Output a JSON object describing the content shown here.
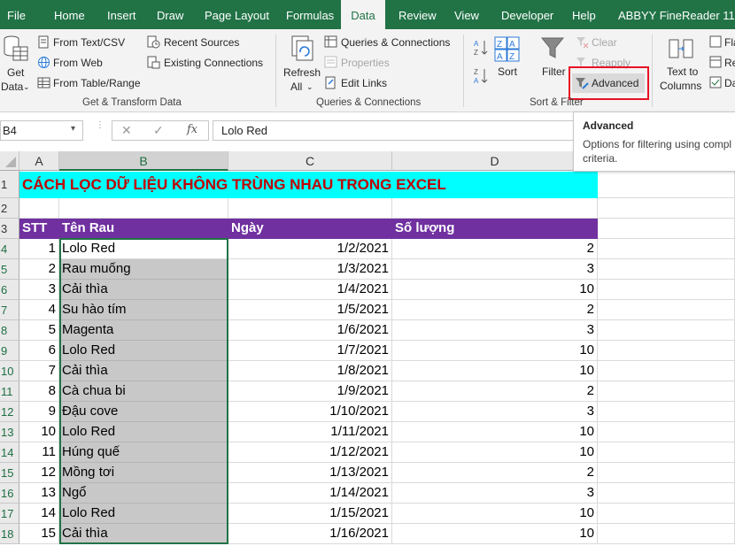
{
  "menu": {
    "tabs": [
      {
        "label": "File"
      },
      {
        "label": "Home"
      },
      {
        "label": "Insert"
      },
      {
        "label": "Draw"
      },
      {
        "label": "Page Layout"
      },
      {
        "label": "Formulas"
      },
      {
        "label": "Data"
      },
      {
        "label": "Review"
      },
      {
        "label": "View"
      },
      {
        "label": "Developer"
      },
      {
        "label": "Help"
      },
      {
        "label": "ABBYY FineReader 11"
      }
    ],
    "active": "Data"
  },
  "ribbon": {
    "get_data": {
      "line1": "Get",
      "line2": "Data"
    },
    "from_text_csv": "From Text/CSV",
    "from_web": "From Web",
    "from_table_range": "From Table/Range",
    "recent_sources": "Recent Sources",
    "existing_connections": "Existing Connections",
    "group_get_transform": "Get & Transform Data",
    "refresh_all": {
      "line1": "Refresh",
      "line2": "All"
    },
    "queries_connections": "Queries & Connections",
    "properties": "Properties",
    "edit_links": "Edit Links",
    "group_queries": "Queries & Connections",
    "sort": "Sort",
    "filter": "Filter",
    "clear": "Clear",
    "reapply": "Reapply",
    "advanced": "Advanced",
    "group_sort_filter": "Sort & Filter",
    "text_to_columns": {
      "line1": "Text to",
      "line2": "Columns"
    },
    "partial_fl": "Fla",
    "partial_re": "Re",
    "partial_da": "Da"
  },
  "tooltip": {
    "title": "Advanced",
    "text": "Options for filtering using compl criteria."
  },
  "formula_bar": {
    "name_box": "B4",
    "formula": "Lolo Red"
  },
  "sheet": {
    "columns": [
      "A",
      "B",
      "C",
      "D"
    ],
    "title": "CÁCH LỌC DỮ LIỆU KHÔNG TRÙNG NHAU TRONG EXCEL",
    "headers": [
      "STT",
      "Tên Rau",
      "Ngày",
      "Số lượng"
    ],
    "row_numbers": [
      "1",
      "2",
      "3",
      "4",
      "5",
      "6",
      "7",
      "8",
      "9",
      "10",
      "11",
      "12",
      "13",
      "14",
      "15",
      "16",
      "17",
      "18"
    ],
    "rows": [
      {
        "stt": "1",
        "name": "Lolo Red",
        "date": "1/2/2021",
        "qty": "2"
      },
      {
        "stt": "2",
        "name": "Rau muống",
        "date": "1/3/2021",
        "qty": "3"
      },
      {
        "stt": "3",
        "name": "Cải thìa",
        "date": "1/4/2021",
        "qty": "10"
      },
      {
        "stt": "4",
        "name": "Su hào tím",
        "date": "1/5/2021",
        "qty": "2"
      },
      {
        "stt": "5",
        "name": "Magenta",
        "date": "1/6/2021",
        "qty": "3"
      },
      {
        "stt": "6",
        "name": "Lolo Red",
        "date": "1/7/2021",
        "qty": "10"
      },
      {
        "stt": "7",
        "name": "Cải thìa",
        "date": "1/8/2021",
        "qty": "10"
      },
      {
        "stt": "8",
        "name": "Cà chua bi",
        "date": "1/9/2021",
        "qty": "2"
      },
      {
        "stt": "9",
        "name": "Đậu cove",
        "date": "1/10/2021",
        "qty": "3"
      },
      {
        "stt": "10",
        "name": "Lolo Red",
        "date": "1/11/2021",
        "qty": "10"
      },
      {
        "stt": "11",
        "name": "Húng quế",
        "date": "1/12/2021",
        "qty": "10"
      },
      {
        "stt": "12",
        "name": "Mồng tơi",
        "date": "1/13/2021",
        "qty": "2"
      },
      {
        "stt": "13",
        "name": "Ngổ",
        "date": "1/14/2021",
        "qty": "3"
      },
      {
        "stt": "14",
        "name": "Lolo Red",
        "date": "1/15/2021",
        "qty": "10"
      },
      {
        "stt": "15",
        "name": "Cải thìa",
        "date": "1/16/2021",
        "qty": "10"
      }
    ]
  },
  "colors": {
    "accent": "#217346",
    "title_fill": "#00ffff",
    "title_text": "#c00000",
    "header_fill": "#7030a0",
    "selection_fill": "#c8c8c8",
    "highlight_box": "#e81123"
  }
}
